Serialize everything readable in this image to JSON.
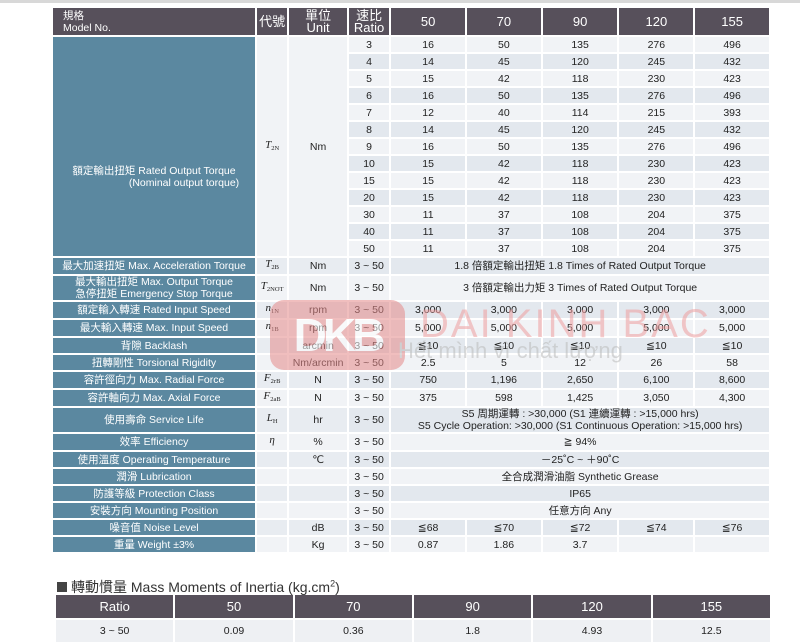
{
  "header": {
    "model_label_zh": "規格",
    "model_label_en": "Model No.",
    "code": "代號",
    "unit_zh": "單位",
    "unit_en": "Unit",
    "ratio_zh": "速比",
    "ratio_en": "Ratio",
    "models": [
      "50",
      "70",
      "90",
      "120",
      "155"
    ]
  },
  "torque": {
    "label": "額定輸出扭矩 Rated Output Torque",
    "sublabel": "(Nominal output torque)",
    "code_main": "T",
    "code_sub": "2N",
    "unit": "Nm",
    "rows": [
      {
        "ratio": "3",
        "values": [
          "16",
          "50",
          "135",
          "276",
          "496"
        ]
      },
      {
        "ratio": "4",
        "values": [
          "14",
          "45",
          "120",
          "245",
          "432"
        ]
      },
      {
        "ratio": "5",
        "values": [
          "15",
          "42",
          "118",
          "230",
          "423"
        ]
      },
      {
        "ratio": "6",
        "values": [
          "16",
          "50",
          "135",
          "276",
          "496"
        ]
      },
      {
        "ratio": "7",
        "values": [
          "12",
          "40",
          "114",
          "215",
          "393"
        ]
      },
      {
        "ratio": "8",
        "values": [
          "14",
          "45",
          "120",
          "245",
          "432"
        ]
      },
      {
        "ratio": "9",
        "values": [
          "16",
          "50",
          "135",
          "276",
          "496"
        ]
      },
      {
        "ratio": "10",
        "values": [
          "15",
          "42",
          "118",
          "230",
          "423"
        ]
      },
      {
        "ratio": "15",
        "values": [
          "15",
          "42",
          "118",
          "230",
          "423"
        ]
      },
      {
        "ratio": "20",
        "values": [
          "15",
          "42",
          "118",
          "230",
          "423"
        ]
      },
      {
        "ratio": "30",
        "values": [
          "11",
          "37",
          "108",
          "204",
          "375"
        ]
      },
      {
        "ratio": "40",
        "values": [
          "11",
          "37",
          "108",
          "204",
          "375"
        ]
      },
      {
        "ratio": "50",
        "values": [
          "11",
          "37",
          "108",
          "204",
          "375"
        ]
      }
    ]
  },
  "specs": [
    {
      "label": [
        "最大加速扭矩 Max. Acceleration Torque"
      ],
      "code_main": "T",
      "code_sub": "2B",
      "unit": "Nm",
      "ratio": "3 ~ 50",
      "merged": [
        "1.8 倍額定輸出扭矩  1.8 Times of Rated Output Torque"
      ]
    },
    {
      "label": [
        "最大輸出扭矩  Max. Output Torque",
        "急停扭矩  Emergency Stop Torque"
      ],
      "code_main": "T",
      "code_sub": "2NOT",
      "unit": "Nm",
      "ratio": "3 ~ 50",
      "merged": [
        "3 倍額定輸出力矩  3 Times of Rated Output Torque"
      ]
    },
    {
      "label": [
        "額定輸入轉速  Rated Input Speed"
      ],
      "code_main": "n",
      "code_sub": "1N",
      "unit": "rpm",
      "ratio": "3 ~ 50",
      "values": [
        "3,000",
        "3,000",
        "3,000",
        "3,000",
        "3,000"
      ]
    },
    {
      "label": [
        "最大輸入轉速  Max. Input Speed"
      ],
      "code_main": "n",
      "code_sub": "1B",
      "unit": "rpm",
      "ratio": "3 ~ 50",
      "values": [
        "5,000",
        "5,000",
        "5,000",
        "5,000",
        "5,000"
      ]
    },
    {
      "label": [
        "背隙  Backlash"
      ],
      "code_main": "",
      "code_sub": "",
      "unit": "arcmin",
      "ratio": "3 ~ 50",
      "values": [
        "≦10",
        "≦10",
        "≦10",
        "≦10",
        "≦10"
      ]
    },
    {
      "label": [
        "扭轉剛性  Torsional Rigidity"
      ],
      "code_main": "",
      "code_sub": "",
      "unit": "Nm/arcmin",
      "ratio": "3 ~ 50",
      "values": [
        "2.5",
        "5",
        "12",
        "26",
        "58"
      ]
    },
    {
      "label": [
        "容許徑向力  Max. Radial Force"
      ],
      "code_main": "F",
      "code_sub": "2rB",
      "unit": "N",
      "ratio": "3 ~ 50",
      "values": [
        "750",
        "1,196",
        "2,650",
        "6,100",
        "8,600"
      ]
    },
    {
      "label": [
        "容許軸向力  Max. Axial Force"
      ],
      "code_main": "F",
      "code_sub": "2aB",
      "unit": "N",
      "ratio": "3 ~ 50",
      "values": [
        "375",
        "598",
        "1,425",
        "3,050",
        "4,300"
      ]
    },
    {
      "label": [
        "使用壽命  Service Life"
      ],
      "code_main": "L",
      "code_sub": "H",
      "unit": "hr",
      "ratio": "3 ~ 50",
      "merged": [
        "S5 周期運轉 : >30,000 (S1 連續運轉 : >15,000 hrs)",
        "S5 Cycle Operation: >30,000 (S1 Continuous Operation: >15,000 hrs)"
      ]
    },
    {
      "label": [
        "效率  Efficiency"
      ],
      "code_main": "η",
      "code_sub": "",
      "unit": "%",
      "ratio": "3 ~ 50",
      "merged": [
        "≧ 94%"
      ]
    },
    {
      "label": [
        "使用溫度  Operating Temperature"
      ],
      "code_main": "",
      "code_sub": "",
      "unit": "℃",
      "ratio": "3 ~ 50",
      "merged": [
        "－25˚C  ~  ＋90˚C"
      ]
    },
    {
      "label": [
        "潤滑  Lubrication"
      ],
      "code_main": "",
      "code_sub": "",
      "unit": "",
      "ratio": "3 ~ 50",
      "merged": [
        "全合成潤滑油脂  Synthetic Grease"
      ]
    },
    {
      "label": [
        "防護等級  Protection Class"
      ],
      "code_main": "",
      "code_sub": "",
      "unit": "",
      "ratio": "3 ~ 50",
      "merged": [
        "IP65"
      ]
    },
    {
      "label": [
        "安裝方向  Mounting Position"
      ],
      "code_main": "",
      "code_sub": "",
      "unit": "",
      "ratio": "3 ~ 50",
      "merged": [
        "任意方向  Any"
      ]
    },
    {
      "label": [
        "噪音值  Noise Level"
      ],
      "code_main": "",
      "code_sub": "",
      "unit": "dB",
      "ratio": "3 ~ 50",
      "values": [
        "≦68",
        "≦70",
        "≦72",
        "≦74",
        "≦76"
      ]
    },
    {
      "label": [
        "重量  Weight  ±3%"
      ],
      "code_main": "",
      "code_sub": "",
      "unit": "Kg",
      "ratio": "3 ~ 50",
      "values": [
        "0.87",
        "1.86",
        "3.7",
        "",
        ""
      ]
    }
  ],
  "inertia": {
    "title_prefix": "轉動慣量 Mass Moments of Inertia (kg.cm",
    "title_sup": "2",
    "title_suffix": ")",
    "headers": [
      "Ratio",
      "50",
      "70",
      "90",
      "120",
      "155"
    ],
    "row": [
      "3 ~ 50",
      "0.09",
      "0.36",
      "1.8",
      "4.93",
      "12.5"
    ]
  },
  "watermark": {
    "logo": "DKB",
    "name": "DAI KINH BAC",
    "slogan": "Hết mình vì chất lượng",
    "color": "#e58a8a"
  },
  "colors": {
    "header": "#57505b",
    "label": "#5b88a0",
    "cell": "#f1f3f6",
    "cell_alt": "#e3e8ee"
  }
}
